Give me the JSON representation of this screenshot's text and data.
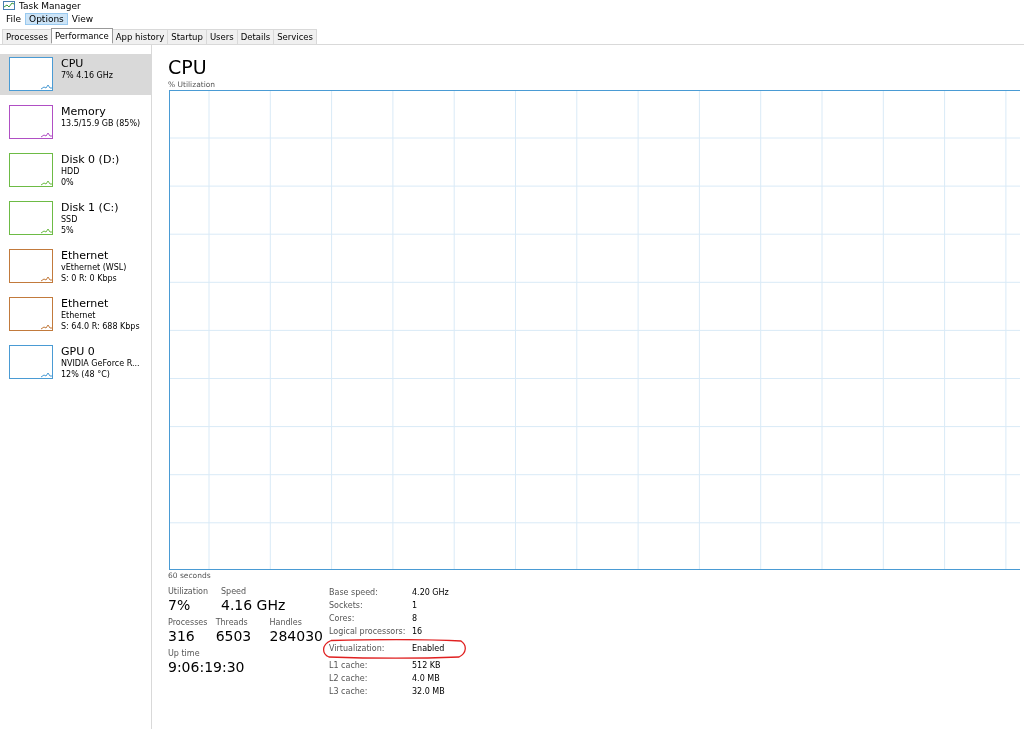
{
  "window": {
    "title": "Task Manager"
  },
  "menu": [
    {
      "label": "File",
      "selected": false
    },
    {
      "label": "Options",
      "selected": true
    },
    {
      "label": "View",
      "selected": false
    }
  ],
  "tabs": [
    {
      "label": "Processes",
      "selected": false
    },
    {
      "label": "Performance",
      "selected": true
    },
    {
      "label": "App history",
      "selected": false
    },
    {
      "label": "Startup",
      "selected": false
    },
    {
      "label": "Users",
      "selected": false
    },
    {
      "label": "Details",
      "selected": false
    },
    {
      "label": "Services",
      "selected": false
    }
  ],
  "sidebar": {
    "items": [
      {
        "title": "CPU",
        "lines": [
          "7% 4.16 GHz"
        ],
        "color": "#4a9bd4",
        "selected": true
      },
      {
        "title": "Memory",
        "lines": [
          "13.5/15.9 GB (85%)"
        ],
        "color": "#b04fc4",
        "selected": false
      },
      {
        "title": "Disk 0 (D:)",
        "lines": [
          "HDD",
          "0%"
        ],
        "color": "#6dbb45",
        "selected": false
      },
      {
        "title": "Disk 1 (C:)",
        "lines": [
          "SSD",
          "5%"
        ],
        "color": "#6dbb45",
        "selected": false
      },
      {
        "title": "Ethernet",
        "lines": [
          "vEthernet (WSL)",
          "S: 0 R: 0 Kbps"
        ],
        "color": "#c27a3c",
        "selected": false
      },
      {
        "title": "Ethernet",
        "lines": [
          "Ethernet",
          "S: 64.0 R: 688 Kbps"
        ],
        "color": "#c27a3c",
        "selected": false
      },
      {
        "title": "GPU 0",
        "lines": [
          "NVIDIA GeForce R...",
          "12% (48 °C)"
        ],
        "color": "#4a9bd4",
        "selected": false
      }
    ]
  },
  "main": {
    "title": "CPU",
    "graph_label": "% Utilization",
    "time_label": "60 seconds",
    "stats": [
      {
        "label": "Utilization",
        "value": "7%"
      },
      {
        "label": "Speed",
        "value": "4.16 GHz"
      },
      {
        "label": "Processes",
        "value": "316"
      },
      {
        "label": "Threads",
        "value": "6503"
      },
      {
        "label": "Handles",
        "value": "284030"
      },
      {
        "label": "Up time",
        "value": "9:06:19:30"
      }
    ],
    "details": [
      {
        "label": "Base speed:",
        "value": "4.20 GHz"
      },
      {
        "label": "Sockets:",
        "value": "1"
      },
      {
        "label": "Cores:",
        "value": "8"
      },
      {
        "label": "Logical processors:",
        "value": "16"
      },
      {
        "label": "Virtualization:",
        "value": "Enabled"
      },
      {
        "label": "L1 cache:",
        "value": "512 KB"
      },
      {
        "label": "L2 cache:",
        "value": "4.0 MB"
      },
      {
        "label": "L3 cache:",
        "value": "32.0 MB"
      }
    ]
  }
}
